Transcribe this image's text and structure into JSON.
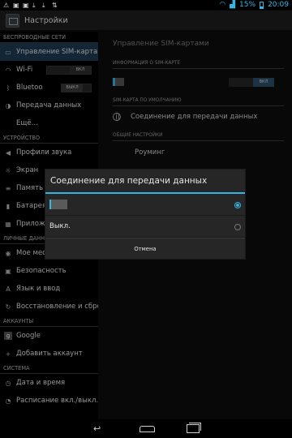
{
  "status_bar": {
    "battery_percent": "15%",
    "time": "20:09",
    "accent_color": "#33b5e5"
  },
  "action_bar": {
    "title": "Настройки"
  },
  "left_pane": {
    "sections": [
      {
        "header": "БЕСПРОВОДНЫЕ СЕТИ",
        "items": [
          {
            "label": "Управление SIM-картами",
            "icon": "sim-icon",
            "selected": true
          },
          {
            "label": "Wi-Fi",
            "icon": "wifi-icon",
            "toggle": "ВКЛ"
          },
          {
            "label": "Bluetoo",
            "icon": "bluetooth-icon",
            "toggle": "ВЫКЛ"
          },
          {
            "label": "Передача данных",
            "icon": "data-usage-icon"
          },
          {
            "label": "Ещё…",
            "icon": ""
          }
        ]
      },
      {
        "header": "УСТРОЙСТВО",
        "items": [
          {
            "label": "Профили звука",
            "icon": "volume-icon"
          },
          {
            "label": "Экран",
            "icon": "display-icon"
          },
          {
            "label": "Память",
            "icon": "storage-icon"
          },
          {
            "label": "Батарея",
            "icon": "battery-icon"
          },
          {
            "label": "Приложен",
            "icon": "apps-icon"
          }
        ]
      },
      {
        "header": "ЛИЧНЫЕ ДАННЫЕ",
        "items": [
          {
            "label": "Мое местоположение",
            "icon": "location-icon"
          },
          {
            "label": "Безопасность",
            "icon": "lock-icon"
          },
          {
            "label": "Язык и ввод",
            "icon": "language-icon"
          },
          {
            "label": "Восстановление и сброс",
            "icon": "backup-icon"
          }
        ]
      },
      {
        "header": "АККАУНТЫ",
        "items": [
          {
            "label": "Google",
            "icon": "google-icon"
          },
          {
            "label": "Добавить аккаунт",
            "icon": "plus-icon"
          }
        ]
      },
      {
        "header": "СИСТЕМА",
        "items": [
          {
            "label": "Дата и время",
            "icon": "clock-icon"
          },
          {
            "label": "Расписание вкл./выкл.",
            "icon": "schedule-icon"
          }
        ]
      }
    ]
  },
  "right_pane": {
    "title": "Управление SIM-картами",
    "sim_info_header": "ИНФОРМАЦИЯ О SIM-КАРТЕ",
    "sim_toggle": "ВКЛ",
    "default_sim_header": "SIM-КАРТА ПО УМОЛЧАНИЮ",
    "data_connection_label": "Соединение для передачи данных",
    "general_header": "ОБЩИЕ НАСТРОЙКИ",
    "roaming_label": "Роуминг"
  },
  "dialog": {
    "title": "Соединение для передачи данных",
    "options": [
      {
        "label": "",
        "has_sim_icon": true,
        "checked": true
      },
      {
        "label": "Выкл.",
        "has_sim_icon": false,
        "checked": false
      }
    ],
    "cancel_label": "Отмена"
  }
}
